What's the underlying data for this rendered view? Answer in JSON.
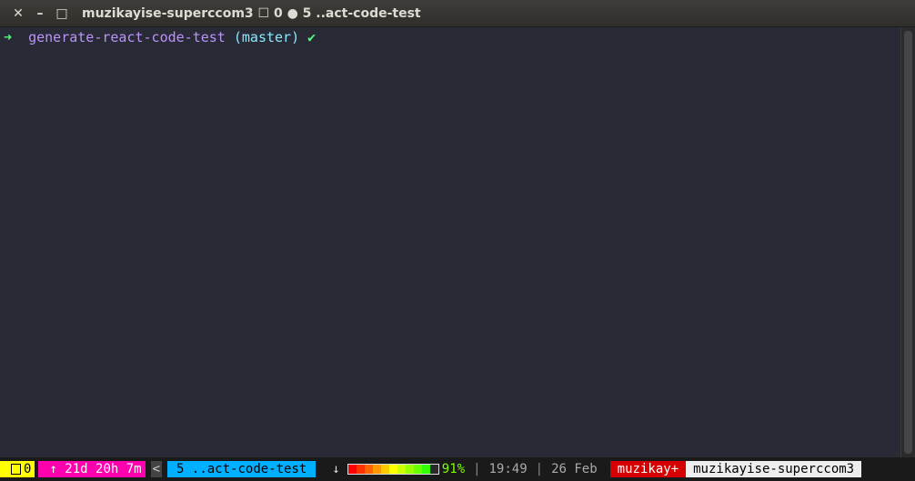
{
  "window": {
    "title": "muzikayise-superccom3 ☐ 0 ● 5 ..act-code-test",
    "close_glyph": "✕",
    "minimize_glyph": "–",
    "maximize_glyph": "□"
  },
  "terminal": {
    "prompt_arrow": "➜",
    "directory": "generate-react-code-test",
    "branch": "(master)",
    "check": "✔"
  },
  "statusbar": {
    "session": "0",
    "uptime": "↑ 21d 20h 7m",
    "prev_indicator": "<",
    "window": "5 ..act-code-test",
    "download_arrow": "↓",
    "battery_percent": "91%",
    "battery_level": 0.91,
    "battery_colors": [
      "#ff0000",
      "#ff3300",
      "#ff6600",
      "#ff9900",
      "#ffcc00",
      "#ffff00",
      "#ccff00",
      "#99ff00",
      "#66ff00",
      "#33ff00",
      "#2a2a2a"
    ],
    "sep1": "|",
    "time": "19:49",
    "sep2": "|",
    "date": "26 Feb",
    "user": "muzikay+",
    "host": "muzikayise-superccom3"
  },
  "colors": {
    "background": "#282a36",
    "arrow": "#50fa7b",
    "directory": "#bd93f9",
    "branch": "#8be9fd"
  }
}
